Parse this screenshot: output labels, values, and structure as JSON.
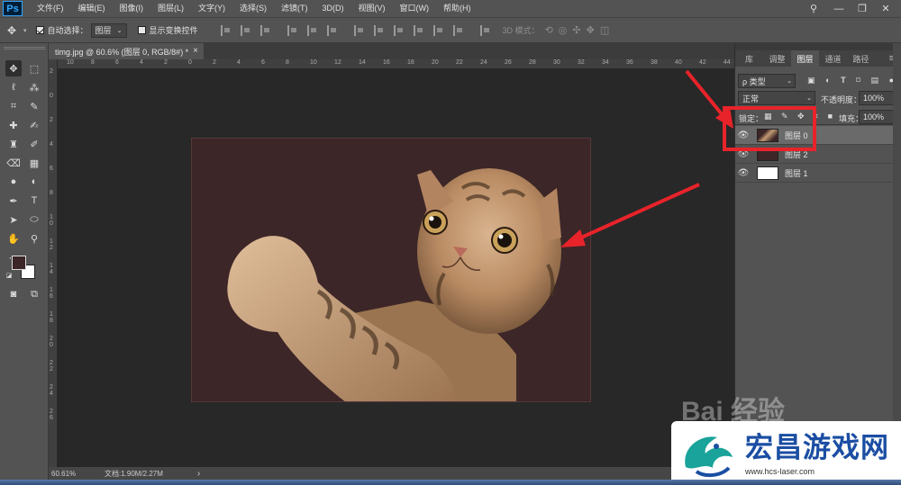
{
  "menu": {
    "logo": "Ps",
    "items": [
      "文件(F)",
      "编辑(E)",
      "图像(I)",
      "图层(L)",
      "文字(Y)",
      "选择(S)",
      "滤镜(T)",
      "3D(D)",
      "视图(V)",
      "窗口(W)",
      "帮助(H)"
    ],
    "minimize": "—",
    "restore": "❐",
    "close": "✕",
    "search_icon": "⚲"
  },
  "options": {
    "auto_select_label": "自动选择：",
    "auto_select_value": "图层",
    "show_transform_label": "显示变换控件",
    "mode3d_label": "3D 模式："
  },
  "document": {
    "tab_title": "timg.jpg @ 60.6% (图层 0, RGB/8#) *",
    "close": "×"
  },
  "ruler": {
    "top_labels": [
      "10",
      "8",
      "6",
      "4",
      "2",
      "0",
      "2",
      "4",
      "6",
      "8",
      "10",
      "12",
      "14",
      "16",
      "18",
      "20",
      "22",
      "24",
      "26",
      "28",
      "30",
      "32",
      "34",
      "36",
      "38",
      "40",
      "42",
      "44"
    ],
    "left_labels": [
      "2",
      "0",
      "2",
      "4",
      "6",
      "8",
      "1\n0",
      "1\n2",
      "1\n4",
      "1\n6",
      "1\n8",
      "2\n0",
      "2\n2",
      "2\n4",
      "2\n6"
    ]
  },
  "status": {
    "zoom": "60.61%",
    "doc_info": "文档:1.90M/2.27M",
    "arrow": "›"
  },
  "panel": {
    "tabs": [
      "库",
      "调整",
      "图层",
      "通道",
      "路径"
    ],
    "active_tab_index": 2,
    "menu_icon": "≡",
    "filter_value": "ρ 类型",
    "blend_mode": "正常",
    "opacity_label": "不透明度：",
    "opacity_value": "100%",
    "lock_label": "锁定：",
    "fill_label": "填充：",
    "fill_value": "100%",
    "layers": [
      {
        "name": "图层 0",
        "selected": true,
        "thumb": "cat"
      },
      {
        "name": "图层 2",
        "selected": false,
        "thumb": "#3c2627"
      },
      {
        "name": "图层 1",
        "selected": false,
        "thumb": "#ffffff"
      }
    ]
  },
  "watermark": {
    "title": "宏昌游戏网",
    "url": "www.hcs-laser.com",
    "baidu_text": "Bai 经验"
  },
  "colors": {
    "foreground": "#3c2627",
    "background": "#ffffff",
    "highlight": "#e8232a"
  }
}
